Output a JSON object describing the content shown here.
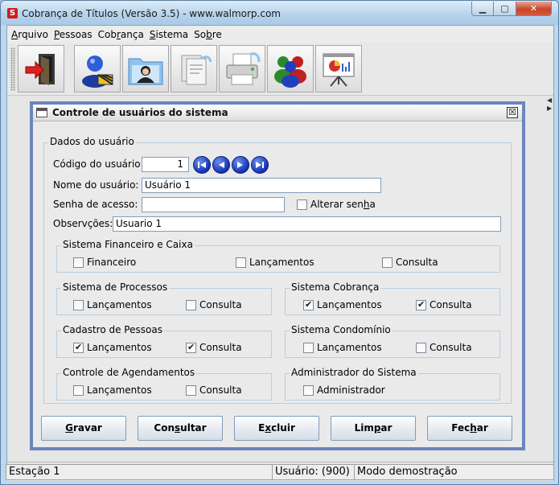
{
  "window": {
    "title": "Cobrança de Títulos (Versão 3.5) - www.walmorp.com",
    "app_icon_letter": "S",
    "minimize_symbol": "▁",
    "maximize_symbol": "▢",
    "close_symbol": "✕"
  },
  "menu": [
    {
      "key": "A",
      "rest": "rquivo"
    },
    {
      "key": "P",
      "rest": "essoas"
    },
    {
      "pre": "Cob",
      "key": "r",
      "rest": "ança"
    },
    {
      "key": "S",
      "rest": "istema"
    },
    {
      "pre": "So",
      "key": "b",
      "rest": "re"
    }
  ],
  "toolbar": {
    "icons": [
      "exit-door-icon",
      "user-admin-icon",
      "people-folder-icon",
      "documents-icon",
      "printer-icon",
      "users-group-icon",
      "presentation-chart-icon"
    ]
  },
  "frame": {
    "title": "Controle de usuários do sistema",
    "close_symbol": "☒"
  },
  "user": {
    "legend": "Dados do usuário",
    "code_label": "Código do usuário:",
    "code_value": "1",
    "name_label": "Nome do usuário:",
    "name_value": "Usuário 1",
    "password_label": "Senha de acesso:",
    "password_value": "",
    "change_password_pre": "Alterar sen",
    "change_password_key": "h",
    "change_password_post": "a",
    "change_password_checked": false,
    "notes_label": "Observções:",
    "notes_value": "Usuario 1"
  },
  "groups": {
    "financeiro": {
      "legend": "Sistema Financeiro e Caixa",
      "items": [
        {
          "label": "Financeiro",
          "checked": false
        },
        {
          "label": "Lançamentos",
          "checked": false
        },
        {
          "label": "Consulta",
          "checked": false
        }
      ]
    },
    "processos": {
      "legend": "Sistema de Processos",
      "items": [
        {
          "label": "Lançamentos",
          "checked": false
        },
        {
          "label": "Consulta",
          "checked": false
        }
      ]
    },
    "cobranca": {
      "legend": "Sistema Cobrança",
      "items": [
        {
          "label": "Lançamentos",
          "checked": true
        },
        {
          "label": "Consulta",
          "checked": true
        }
      ]
    },
    "pessoas": {
      "legend": "Cadastro de Pessoas",
      "items": [
        {
          "label": "Lançamentos",
          "checked": true
        },
        {
          "label": "Consulta",
          "checked": true
        }
      ]
    },
    "condominio": {
      "legend": "Sistema Condomínio",
      "items": [
        {
          "label": "Lançamentos",
          "checked": false
        },
        {
          "label": "Consulta",
          "checked": false
        }
      ]
    },
    "agendamentos": {
      "legend": "Controle de Agendamentos",
      "items": [
        {
          "label": "Lançamentos",
          "checked": false
        },
        {
          "label": "Consulta",
          "checked": false
        }
      ]
    },
    "admin": {
      "legend": "Administrador do Sistema",
      "items": [
        {
          "label": "Administrador",
          "checked": false
        }
      ]
    }
  },
  "buttons": [
    {
      "key": "G",
      "rest": "ravar"
    },
    {
      "pre": "Con",
      "key": "s",
      "rest": "ultar"
    },
    {
      "pre": "E",
      "key": "x",
      "rest": "cluir"
    },
    {
      "pre": "Lim",
      "key": "p",
      "rest": "ar"
    },
    {
      "pre": "Fec",
      "key": "h",
      "rest": "ar"
    }
  ],
  "status": {
    "station": "Estação 1",
    "user": "Usuário: (900) U",
    "mode": "Modo demostração"
  },
  "colors": {
    "frame_border": "#6b85bd",
    "nav_blue": "#1433b0",
    "close_red": "#c7452b"
  }
}
